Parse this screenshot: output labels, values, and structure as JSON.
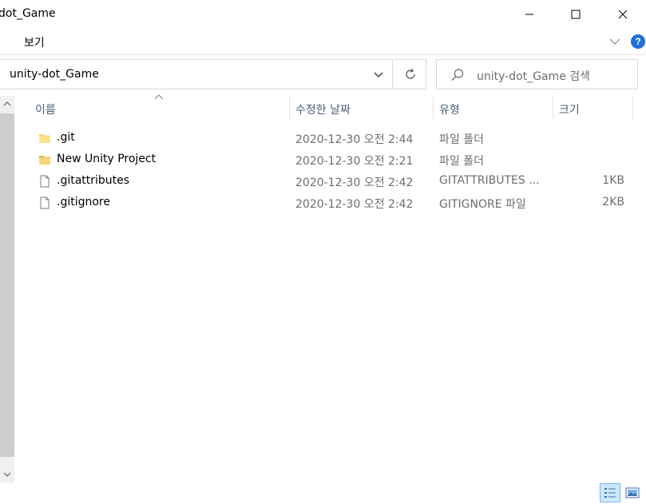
{
  "window": {
    "title": "dot_Game"
  },
  "menu": {
    "view_label": "보기",
    "help_label": "?"
  },
  "address": {
    "path": "unity-dot_Game"
  },
  "search": {
    "placeholder": "unity-dot_Game 검색"
  },
  "columns": {
    "name": "이름",
    "date_modified": "수정한 날짜",
    "type": "유형",
    "size": "크기"
  },
  "files": [
    {
      "name": ".git",
      "date": "2020-12-30 오전 2:44",
      "type": "파일 폴더",
      "size": "",
      "icon": "folder-icon"
    },
    {
      "name": "New Unity Project",
      "date": "2020-12-30 오전 2:21",
      "type": "파일 폴더",
      "size": "",
      "icon": "folder-icon"
    },
    {
      "name": ".gitattributes",
      "date": "2020-12-30 오전 2:42",
      "type": "GITATTRIBUTES ...",
      "size": "1KB",
      "icon": "file-icon"
    },
    {
      "name": ".gitignore",
      "date": "2020-12-30 오전 2:42",
      "type": "GITIGNORE 파일",
      "size": "2KB",
      "icon": "file-icon"
    }
  ],
  "colors": {
    "folder": "#f8d775",
    "accent": "#1e6fd9",
    "header_text": "#4c607a",
    "secondary_text": "#6d6d6d"
  }
}
